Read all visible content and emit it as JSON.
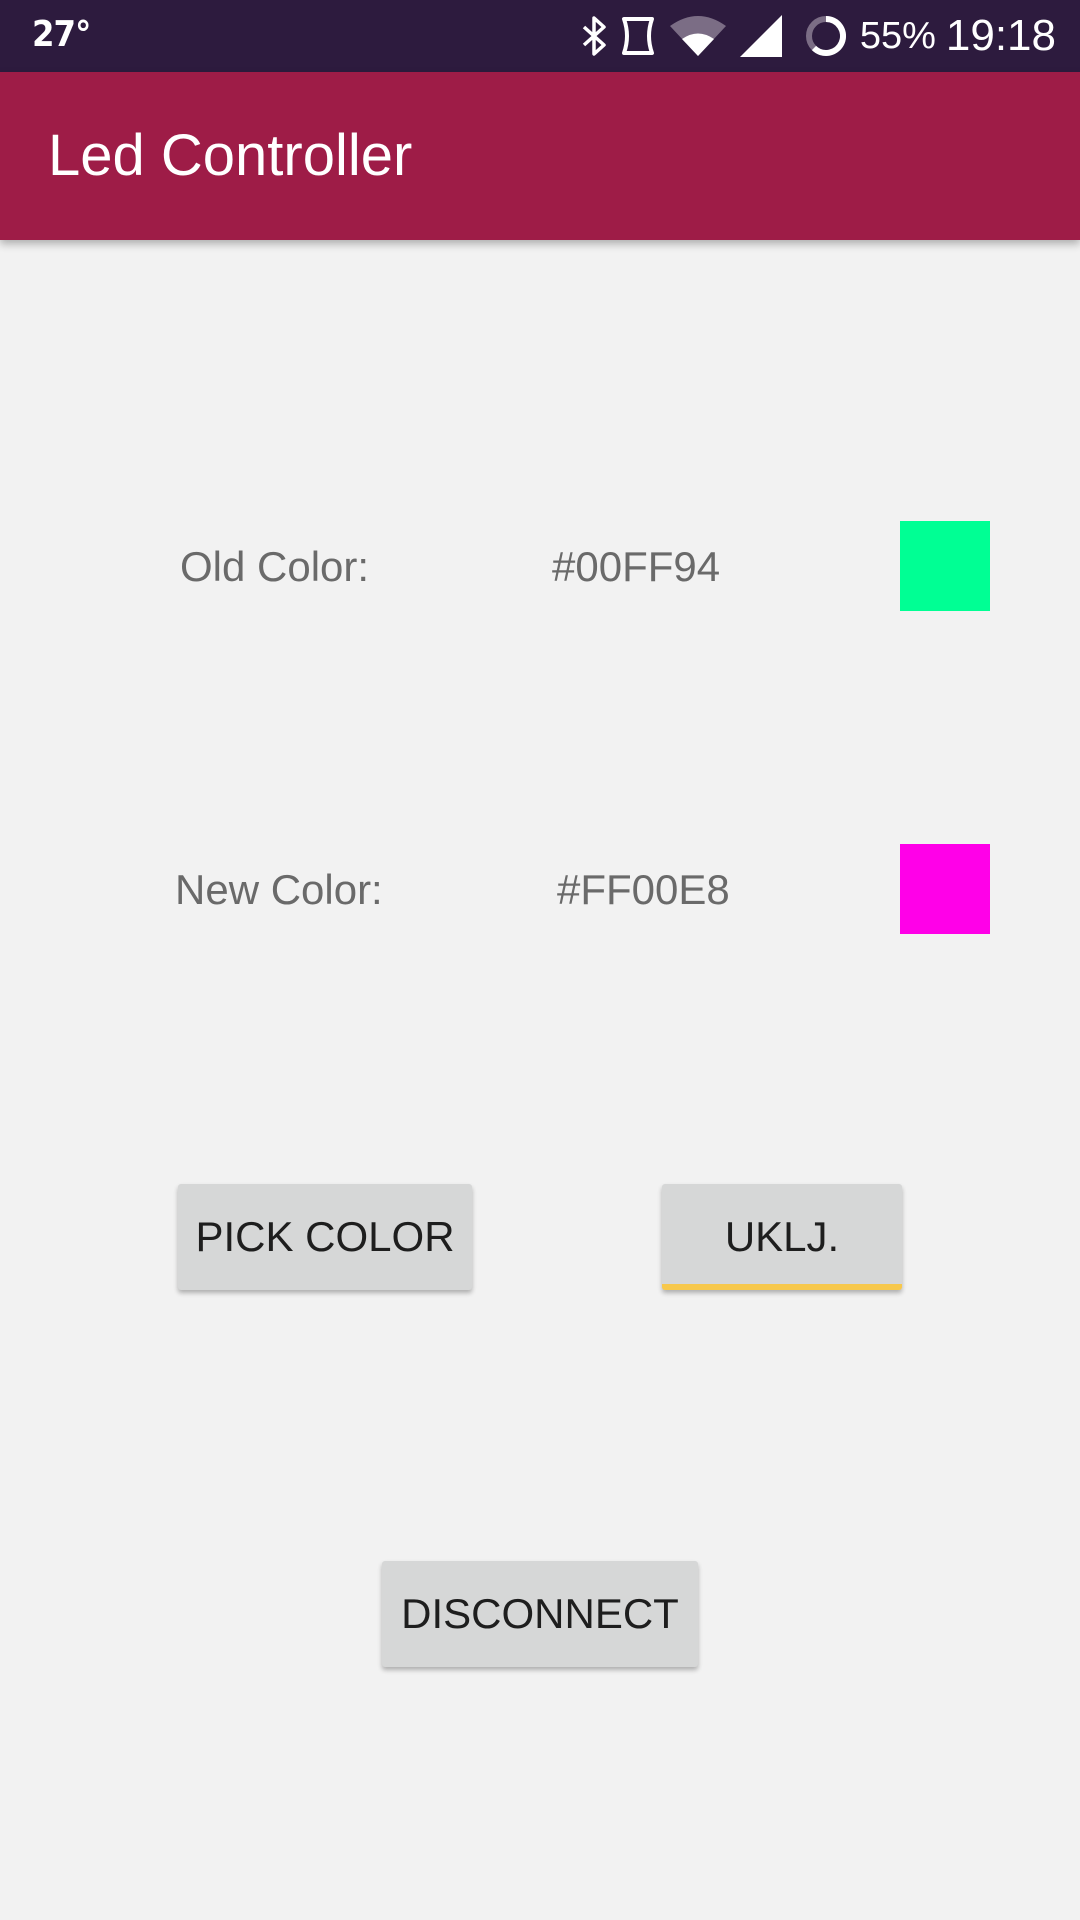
{
  "status_bar": {
    "temperature": "27°",
    "battery_percent": "55%",
    "time": "19:18",
    "icons": [
      "bluetooth-icon",
      "nfc-icon",
      "wifi-icon",
      "cell-signal-icon",
      "battery-ring-icon"
    ],
    "background": "#2d1b3e"
  },
  "app_bar": {
    "title": "Led Controller",
    "background": "#9e1c47"
  },
  "old_color": {
    "label": "Old Color:",
    "value": "#00FF94",
    "swatch_color": "#00FF94"
  },
  "new_color": {
    "label": "New Color:",
    "value": "#FF00E8",
    "swatch_color": "#FF00E8"
  },
  "buttons": {
    "pick_color": "PICK COLOR",
    "toggle": "UKLJ.",
    "disconnect": "DISCONNECT"
  },
  "accent_focus_color": "#f7c84c"
}
